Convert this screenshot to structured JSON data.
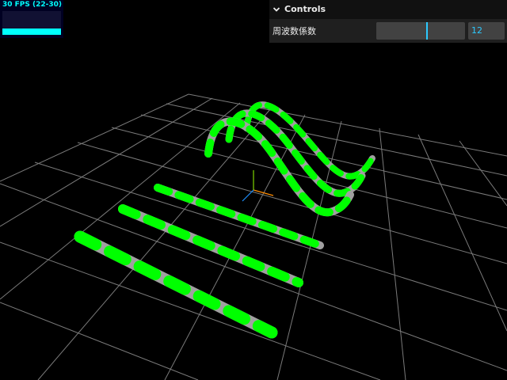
{
  "stats": {
    "fps_text": "30 FPS (22-30)",
    "color": "#00ffff",
    "fps": 30,
    "min": 22,
    "max": 30
  },
  "gui": {
    "title": "Controls",
    "controls": [
      {
        "label": "周波数係数",
        "value": "12",
        "slider_fraction": 0.57
      }
    ],
    "accent": "#2cc9ff"
  },
  "scene": {
    "background": "#000000",
    "grid_color": "#808080",
    "tube_colors": [
      "#00ff00",
      "#a0a0a0"
    ],
    "axes_colors": [
      "#ff8c00",
      "#00ff00",
      "#1e90ff"
    ]
  }
}
